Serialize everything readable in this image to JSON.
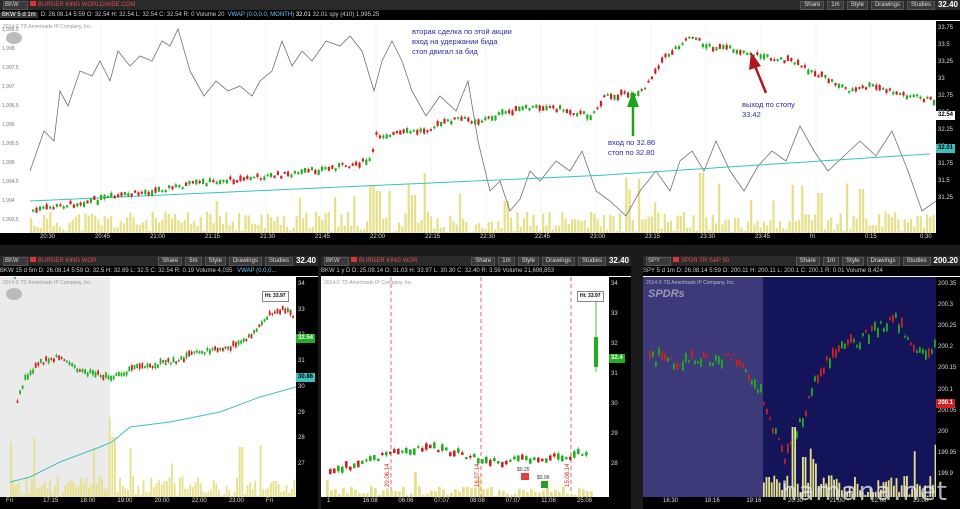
{
  "main": {
    "symbol": "BKW",
    "company": "BURGER KING WORLDWIDE.COM",
    "buttons": [
      "Share",
      "1m",
      "Style",
      "Drawings",
      "Studies"
    ],
    "price": "32.40",
    "info": {
      "sym": "BKW 5 d 1m",
      "text": "D: 26.08.14 5:59  O: 32.54  H: 32.54  L: 32.54  C: 32.54  R: 0  Volume  20",
      "vwap": "VWAP (0.0,0.0, MONTH)",
      "vwap_val": "32.01",
      "tail": "32.01  spy (410)  1,995.25"
    },
    "copyright": "2014 © TD Ameritrade IP Company, Inc.",
    "yticks": [
      "33.75",
      "33.5",
      "33.25",
      "33",
      "32.75",
      "32.5",
      "32.25",
      "32",
      "31.75",
      "31.5",
      "31.25"
    ],
    "ltick": [
      "1,998.5",
      "1,998",
      "1,997.5",
      "1,997",
      "1,996.5",
      "1,996",
      "1,995.5",
      "1,995",
      "1,994.5",
      "1,994",
      "1,993.5"
    ],
    "xticks": [
      "20:30",
      "20:45",
      "21:00",
      "21:15",
      "21:30",
      "21:45",
      "22:00",
      "22:15",
      "22:30",
      "22:45",
      "23:00",
      "23:15",
      "23:30",
      "23:45",
      "fri",
      "0:15",
      "0:30"
    ],
    "badge_price": "32.54",
    "badge_vwap": "32.01",
    "notes": {
      "line1": "вторая сделка по этой акции",
      "line2": "вход на удержании бида",
      "line3": "стоп двигал за бид",
      "entry1": "вход по 32.86",
      "entry2": "стоп по 32.80",
      "exit1": "выход по стопу",
      "exit2": "33.42"
    }
  },
  "left": {
    "symbol": "BKW",
    "company": "BURGER KING WOR",
    "buttons": [
      "Share",
      "5m",
      "Style",
      "Drawings",
      "Studies"
    ],
    "price": "32.40",
    "info": "BKW 15 d 5m  D: 26.08.14 5:59  O: 32.5  H: 32.69  L: 32.5  C: 32.54  R: 0.19  Volume  4,035",
    "vwap": "VWAP (0.0,0...",
    "copyright": "2014 © TD Ameritrade IP Company, Inc.",
    "hi": "Hi: 33.97",
    "yticks": [
      "34",
      "33",
      "32",
      "31",
      "30",
      "29",
      "28",
      "27"
    ],
    "xticks": [
      "Fri",
      "17:15",
      "18:00",
      "19:00",
      "20:00",
      "22:00",
      "23:00",
      "Fri"
    ],
    "badge_price": "32.54",
    "badge_vwap": "30.86"
  },
  "mid": {
    "symbol": "BKW",
    "company": "BURGER KING WOR",
    "buttons": [
      "Share",
      "1m",
      "Style",
      "Drawings",
      "Studies"
    ],
    "price": "32.40",
    "info": "BKW 1 y D  D: 25.08.14  O: 31.03  H: 33.97  L: 30.30  C: 32.40  R: 3.59  Volume  21,698,853",
    "copyright": "2014 © TD Ameritrade IP Company, Inc.",
    "hi": "Hi: 33.97",
    "yticks": [
      "34",
      "33",
      "32",
      "31",
      "30",
      "29",
      "28"
    ],
    "xticks": [
      "1",
      "16:08",
      "06:06",
      "07:07",
      "08:08",
      "07:07",
      "11:08",
      "25:08"
    ],
    "badge_price": "32.4",
    "earn": [
      "20.06.14",
      "16.07.14",
      "15.08.14"
    ],
    "divs": [
      "$0.25",
      "$0.06"
    ]
  },
  "right": {
    "symbol": "SPY",
    "company": "SPDR TR S&P 50",
    "buttons": [
      "Share",
      "1m",
      "Style",
      "Drawings",
      "Studies"
    ],
    "price": "200.20",
    "info": "SPY 5 d 1m  D: 26.08.14 5:59  O: 200.11  H: 200.11  L: 200.1  C: 200.1  R: 0.01  Volume  8,424",
    "copyright": "2014 © TD Ameritrade IP Company, Inc.",
    "brand": "SPDRs",
    "yticks": [
      "200.35",
      "200.3",
      "200.25",
      "200.2",
      "200.15",
      "200.1",
      "200.05",
      "200",
      "199.95",
      "199.9"
    ],
    "xticks": [
      "16:30",
      "18:16",
      "19:16",
      "20:30",
      "21:00",
      "22:00",
      "23:00"
    ],
    "badge_price": "200.1"
  },
  "watermark": "hamana.net",
  "colors": {
    "up": "#22b022",
    "down": "#d02020",
    "volume": "#e6e08a",
    "vwap": "#40c0c0",
    "compare": "#707070",
    "annotation": "#2a2aa8",
    "arrow_entry": "#1aa41a",
    "arrow_exit": "#b01820",
    "spy_bg": "#14145a"
  }
}
